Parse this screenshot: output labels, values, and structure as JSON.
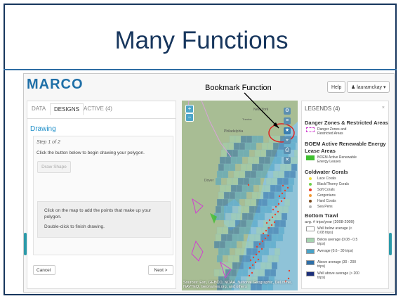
{
  "slide": {
    "title": "Many Functions",
    "annotation": "Bookmark Function"
  },
  "header": {
    "brand": "MARCO",
    "help": "Help",
    "user": "♟ lauramckay ▾"
  },
  "tabs": [
    {
      "label": "DATA"
    },
    {
      "label": "DESIGNS"
    },
    {
      "label": "ACTIVE (4)"
    }
  ],
  "drawing": {
    "title": "Drawing",
    "step": "Step 1 of 2",
    "instruction": "Click the button below to begin drawing your polygon.",
    "draw_button": "Draw Shape",
    "info_text": "Click on the map to add the points that make up your polygon.",
    "info_text2": "Double-click to finish drawing.",
    "cancel": "Cancel",
    "next": "Next >"
  },
  "map": {
    "attribution": "Sources: Esri, GEBCO, NOAA, National Geographic, DeLorme, NAVTEQ, Geonames.org, and others",
    "labels": {
      "new_york": "New York",
      "trenton": "Trenton",
      "philadelphia": "Philadelphia",
      "dover": "Dover"
    }
  },
  "legend": {
    "title": "LEGENDS (4)",
    "close": "×",
    "danger": {
      "title": "Danger Zones & Restricted Areas",
      "item": "Danger Zones and Restricted Areas"
    },
    "boem": {
      "title": "BOEM Active Renewable Energy Lease Areas",
      "item": "BOEM Active Renewable Energy Leases"
    },
    "corals": {
      "title": "Coldwater Corals",
      "items": [
        "Lace Corals",
        "Black/Thorny Corals",
        "Soft Corals",
        "Gorgonians",
        "Hard Corals",
        "Sea Pens"
      ]
    },
    "trawl": {
      "title": "Bottom Trawl",
      "subtitle": "avg. # trips/year (2008-2009)",
      "items": [
        "Well below average (< 0.08 trips)",
        "Below average (0.08 - 0.5 trips)",
        "Average (0.6 - 30 trips)",
        "Above average (30 - 200 trips)",
        "Well above average (> 200 trips)"
      ]
    }
  },
  "colors": {
    "title": "#17365d",
    "brand": "#1f6fa7",
    "accent": "#1f8fc9",
    "annotation_circle": "#e02020",
    "boem": "#3fbf2f",
    "coral_colors": [
      "#f2e13a",
      "#6fd04a",
      "#e8412c",
      "#f29a33",
      "#7a4a1f",
      "#b8b8b8"
    ],
    "trawl_colors": [
      "#ffffff",
      "#a6d3b0",
      "#4aa3c8",
      "#2e6fa8",
      "#1b2f7a"
    ]
  }
}
